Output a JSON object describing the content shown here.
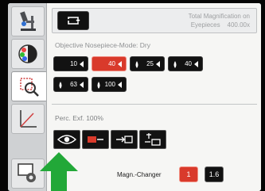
{
  "header": {
    "magnification_label": "Total Magnification on",
    "eyepieces_label": "Eyepieces",
    "magnification_value": "400.00x"
  },
  "nosepiece": {
    "mode_label": "Objective Nosepiece-Mode:",
    "mode_value": "Dry",
    "row1": [
      {
        "label": "10",
        "selected": false,
        "immersion": false
      },
      {
        "label": "40",
        "selected": true,
        "immersion": false
      },
      {
        "label": "25",
        "selected": false,
        "immersion": true
      },
      {
        "label": "40",
        "selected": false,
        "immersion": true
      }
    ],
    "row2": [
      {
        "label": "63",
        "selected": false,
        "immersion": true
      },
      {
        "label": "100",
        "selected": false,
        "immersion": true
      }
    ]
  },
  "fluorescence": {
    "label": "Perc. Exf. 100%"
  },
  "light_path": {
    "buttons": [
      "eye-icon",
      "camera-left-icon",
      "camera-port-icon",
      "lamp-port-icon"
    ]
  },
  "magnification_changer": {
    "label": "Magn.-Changer",
    "options": [
      {
        "label": "1",
        "selected": true
      },
      {
        "label": "1.6",
        "selected": false
      }
    ]
  },
  "colors": {
    "accent_red": "#d93a2b",
    "button_black": "#121212",
    "arrow_green": "#22a838"
  }
}
